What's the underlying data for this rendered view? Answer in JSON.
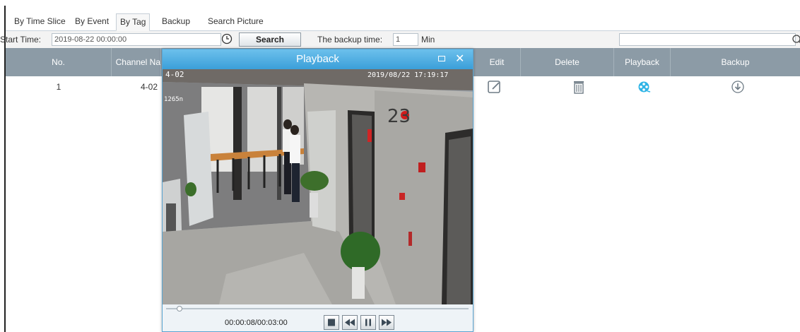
{
  "tabs": [
    {
      "label": "By Time Slice"
    },
    {
      "label": "By Event"
    },
    {
      "label": "By Tag",
      "active": true
    },
    {
      "label": "Backup"
    },
    {
      "label": "Search Picture"
    }
  ],
  "toolbar": {
    "start_time_label": "Start Time:",
    "start_time_value": "2019-08-22 00:00:00",
    "clock_icon": "clock-icon",
    "search_label": "Search",
    "backup_time_label": "The backup time:",
    "backup_time_value": "1",
    "backup_time_unit": "Min",
    "filter_value": "",
    "filter_icon": "search-icon"
  },
  "table": {
    "headers": [
      "No.",
      "Channel Na",
      "Edit",
      "Delete",
      "Playback",
      "Backup"
    ],
    "rows": [
      {
        "no": "1",
        "channel": "4-02",
        "edit_icon": "edit-icon",
        "delete_icon": "trash-icon",
        "playback_icon": "film-reel-icon",
        "backup_icon": "download-icon"
      }
    ]
  },
  "playback": {
    "title": "Playback",
    "osd_channel": "4-02",
    "osd_timestamp": "2019/08/22 17:19:17",
    "osd_small": "1265n",
    "time_display": "00:00:08/00:03:00",
    "progress": 0.044,
    "controls": [
      "stop-icon",
      "rewind-icon",
      "pause-icon",
      "fast-forward-icon"
    ],
    "colors": {
      "title_bar": "#4aaee2",
      "header": "#8c9ba6",
      "accent": "#3aa9d8"
    }
  }
}
